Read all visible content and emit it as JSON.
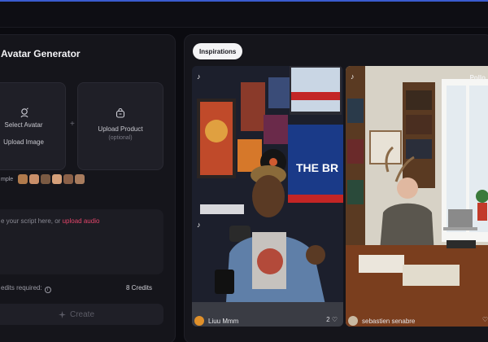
{
  "panel": {
    "title": "Avatar Generator",
    "select_avatar": "Select Avatar",
    "upload_image": "Upload Image",
    "upload_product": "Upload Product",
    "optional": "(optional)",
    "plus": "+",
    "example_label": "mple",
    "script_placeholder": "e your script here, or ",
    "script_link": "upload audio",
    "credits_label": "edits required:",
    "credits_value": "8 Credits",
    "create_label": "Create",
    "colors": {
      "link": "#e2456a"
    }
  },
  "inspirations": {
    "chip": "Inspirations",
    "items": [
      {
        "author": "Liuu Mmm",
        "likes": "2",
        "watermark": ""
      },
      {
        "author": "sebastien senabre",
        "likes": "",
        "watermark": "Pollo"
      }
    ],
    "tv_text": "THE BR"
  },
  "icons": {
    "avatar": "avatar-upload-icon",
    "product": "bag-icon",
    "info": "info-icon",
    "create": "sparkle-icon",
    "like": "heart-icon",
    "tiktok": "tiktok-icon"
  }
}
